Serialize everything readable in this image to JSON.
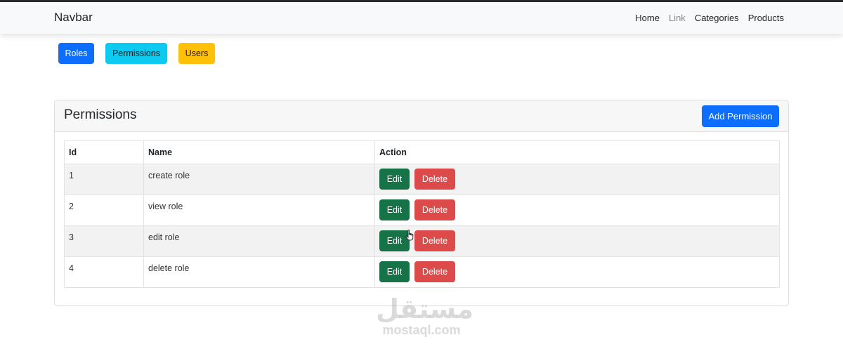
{
  "navbar": {
    "brand": "Navbar",
    "links": [
      {
        "label": "Home",
        "muted": false
      },
      {
        "label": "Link",
        "muted": true
      },
      {
        "label": "Categories",
        "muted": false
      },
      {
        "label": "Products",
        "muted": false
      }
    ]
  },
  "pills": [
    {
      "label": "Roles",
      "color": "#0d6efd"
    },
    {
      "label": "Permissions",
      "color": "#0dcaf0"
    },
    {
      "label": "Users",
      "color": "#ffc107"
    }
  ],
  "card": {
    "title": "Permissions",
    "add_button": "Add Permission"
  },
  "table": {
    "headers": [
      "Id",
      "Name",
      "Action"
    ],
    "rows": [
      {
        "id": "1",
        "name": "create role"
      },
      {
        "id": "2",
        "name": "view role"
      },
      {
        "id": "3",
        "name": "edit role"
      },
      {
        "id": "4",
        "name": "delete role"
      }
    ],
    "edit_label": "Edit",
    "delete_label": "Delete"
  },
  "colors": {
    "primary": "#0d6efd",
    "info": "#0dcaf0",
    "warning": "#ffc107",
    "success": "#157347",
    "danger": "#dc4a4a"
  },
  "watermark": {
    "arabic": "مستقل",
    "latin": "mostaql.com"
  },
  "icons": {
    "cursor": "hand-pointer-icon"
  }
}
